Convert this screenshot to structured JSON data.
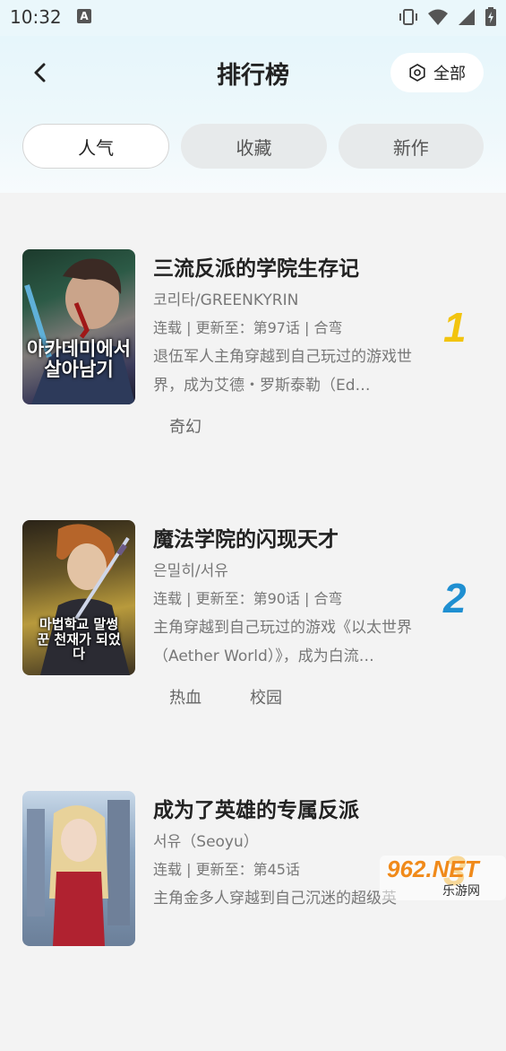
{
  "status_bar": {
    "time": "10:32",
    "notif_icon": "A"
  },
  "header": {
    "title": "排行榜",
    "filter_label": "全部"
  },
  "tabs": [
    {
      "label": "人气",
      "active": true
    },
    {
      "label": "收藏",
      "active": false
    },
    {
      "label": "新作",
      "active": false
    }
  ],
  "items": [
    {
      "rank": "1",
      "rank_color": "#f2c40f",
      "title": "三流反派的学院生存记",
      "author": "코리타/GREENKYRIN",
      "status": "连载 | 更新至：第97话 | 合弯",
      "desc": "退伍军人主角穿越到自己玩过的游戏世界，成为艾德・罗斯泰勒（Ed…",
      "tags": [
        "奇幻"
      ],
      "cover_text": "아카데미에서 살아남기"
    },
    {
      "rank": "2",
      "rank_color": "#1f8fd1",
      "title": "魔法学院的闪现天才",
      "author": "은밀히/서유",
      "status": "连载 | 更新至：第90话 | 合弯",
      "desc": "主角穿越到自己玩过的游戏《以太世界（Aether World）》，成为白流…",
      "tags": [
        "热血",
        "校园"
      ],
      "cover_text": "마법학교 말썽꾼 천재가 되었다"
    },
    {
      "rank": "3",
      "rank_color": "#f0a81c",
      "title": "成为了英雄的专属反派",
      "author": "서유（Seoyu）",
      "status": "连载 | 更新至：第45话",
      "desc": "主角金多人穿越到自己沉迷的超级英",
      "tags": [],
      "cover_text": ""
    }
  ],
  "watermark": {
    "text": "962.NET",
    "sub": "乐游网"
  }
}
